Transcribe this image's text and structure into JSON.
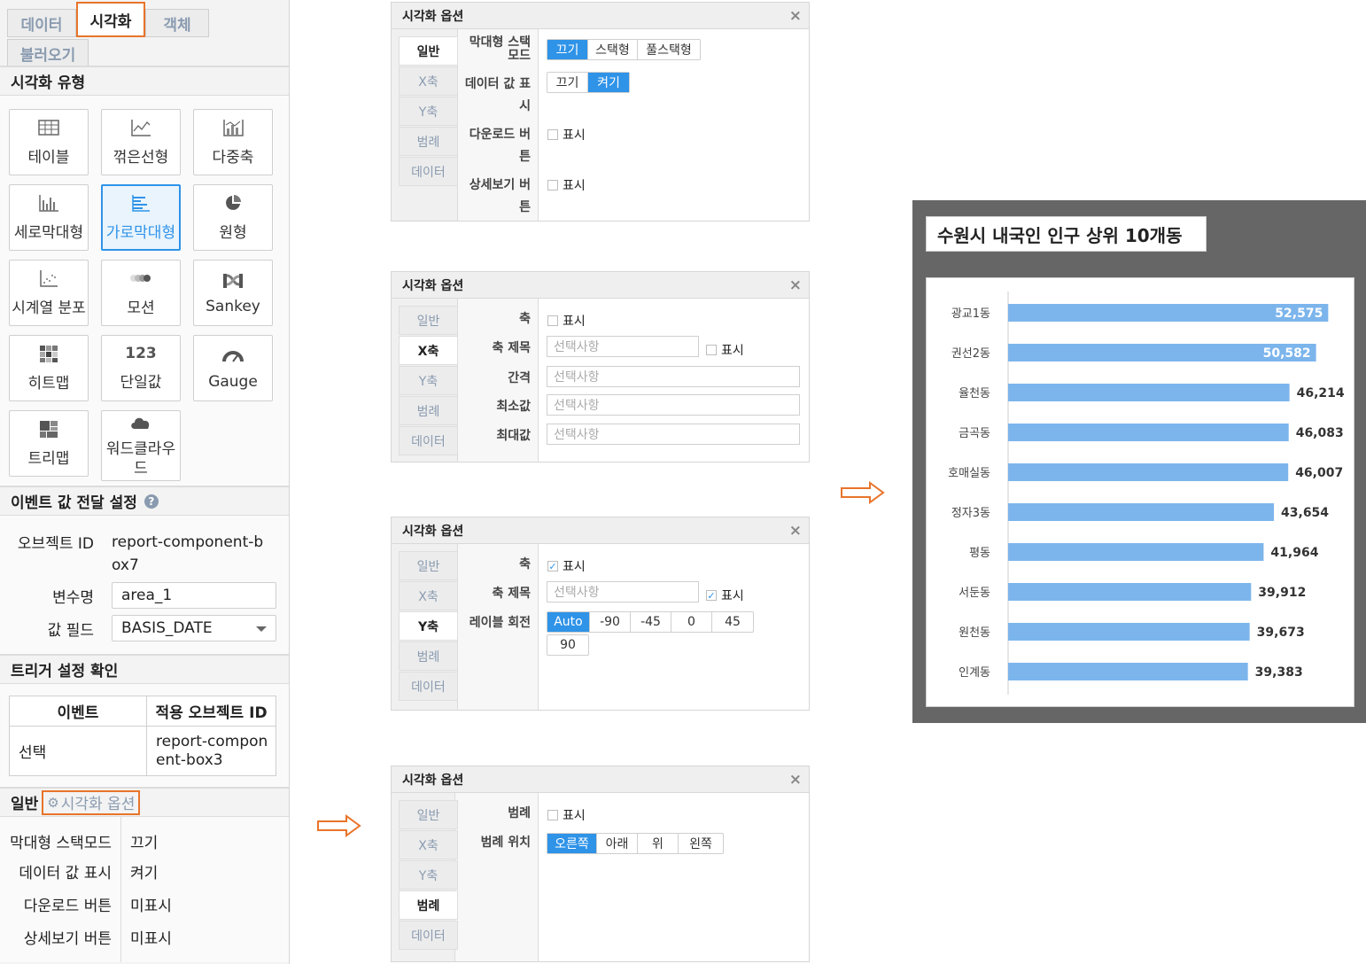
{
  "left_panel": {
    "tabs": [
      "데이터",
      "시각화",
      "객체",
      "불러오기"
    ],
    "viz_type_title": "시각화 유형",
    "viz_types": [
      {
        "label": "테이블",
        "icon": "table-icon"
      },
      {
        "label": "꺾은선형",
        "icon": "line-chart-icon"
      },
      {
        "label": "다중축",
        "icon": "multi-axis-icon"
      },
      {
        "label": "세로막대형",
        "icon": "column-chart-icon"
      },
      {
        "label": "가로막대형",
        "icon": "bar-chart-icon",
        "selected": true
      },
      {
        "label": "원형",
        "icon": "pie-chart-icon"
      },
      {
        "label": "시계열 분포",
        "icon": "timeseries-icon"
      },
      {
        "label": "모션",
        "icon": "motion-icon"
      },
      {
        "label": "Sankey",
        "icon": "sankey-icon"
      },
      {
        "label": "히트맵",
        "icon": "heatmap-icon"
      },
      {
        "label": "단일값",
        "icon": "single-value-icon",
        "icon_text": "123"
      },
      {
        "label": "Gauge",
        "icon": "gauge-icon"
      },
      {
        "label": "트리맵",
        "icon": "treemap-icon"
      },
      {
        "label": "워드클라우드",
        "icon": "wordcloud-icon"
      }
    ],
    "event": {
      "title": "이벤트 값 전달 설정",
      "object_id_label": "오브젝트 ID",
      "object_id_value": "report-component-box7",
      "var_label": "변수명",
      "var_value": "area_1",
      "field_label": "값 필드",
      "field_value": "BASIS_DATE"
    },
    "trigger": {
      "title": "트리거 설정 확인",
      "headers": [
        "이벤트",
        "적용 오브젝트 ID"
      ],
      "rows": [
        [
          "선택",
          "report-component-box3"
        ]
      ]
    },
    "general": {
      "title": "일반",
      "options_link": "시각화 옵션",
      "rows": [
        {
          "label": "막대형 스택모드",
          "value": "끄기"
        },
        {
          "label": "데이터 값 표시",
          "value": "켜기"
        },
        {
          "label": "다운로드 버튼",
          "value": "미표시"
        },
        {
          "label": "상세보기 버튼",
          "value": "미표시"
        }
      ]
    }
  },
  "dialog": {
    "title": "시각화 옵션",
    "close": "×",
    "tabs": [
      "일반",
      "X축",
      "Y축",
      "범례",
      "데이터"
    ],
    "general": {
      "stack_label": "막대형 스택모드",
      "stack_options": [
        "끄기",
        "스택형",
        "풀스택형"
      ],
      "datavalue_label": "데이터 값 표시",
      "datavalue_options": [
        "끄기",
        "켜기"
      ],
      "download_label": "다운로드 버튼",
      "detail_label": "상세보기 버튼",
      "show": "표시"
    },
    "xaxis": {
      "axis_label": "축",
      "title_label": "축 제목",
      "interval_label": "간격",
      "min_label": "최소값",
      "max_label": "최대값",
      "placeholder": "선택사항",
      "show": "표시"
    },
    "yaxis": {
      "axis_label": "축",
      "title_label": "축 제목",
      "rotate_label": "레이블 회전",
      "rotate_options": [
        "Auto",
        "-90",
        "-45",
        "0",
        "45",
        "90"
      ],
      "placeholder": "선택사항",
      "show": "표시"
    },
    "legend": {
      "legend_label": "범례",
      "pos_label": "범례 위치",
      "pos_options": [
        "오른쪽",
        "아래",
        "위",
        "왼쪽"
      ],
      "show": "표시"
    }
  },
  "chart_data": {
    "type": "bar",
    "orientation": "horizontal",
    "title": "수원시 내국인 인구 상위 10개동",
    "categories": [
      "광교1동",
      "권선2동",
      "율천동",
      "금곡동",
      "호매실동",
      "정자3동",
      "평동",
      "서둔동",
      "원천동",
      "인계동"
    ],
    "values": [
      52575,
      50582,
      46214,
      46083,
      46007,
      43654,
      41964,
      39912,
      39673,
      39383
    ],
    "value_labels": [
      "52,575",
      "50,582",
      "46,214",
      "46,083",
      "46,007",
      "43,654",
      "41,964",
      "39,912",
      "39,673",
      "39,383"
    ],
    "xlim": [
      0,
      55000
    ],
    "bar_color": "#7cb5ec",
    "grid": false,
    "legend": "none"
  },
  "colors": {
    "accent": "#2f93e8",
    "highlight": "#e8742a",
    "chart_bg": "#666666"
  }
}
